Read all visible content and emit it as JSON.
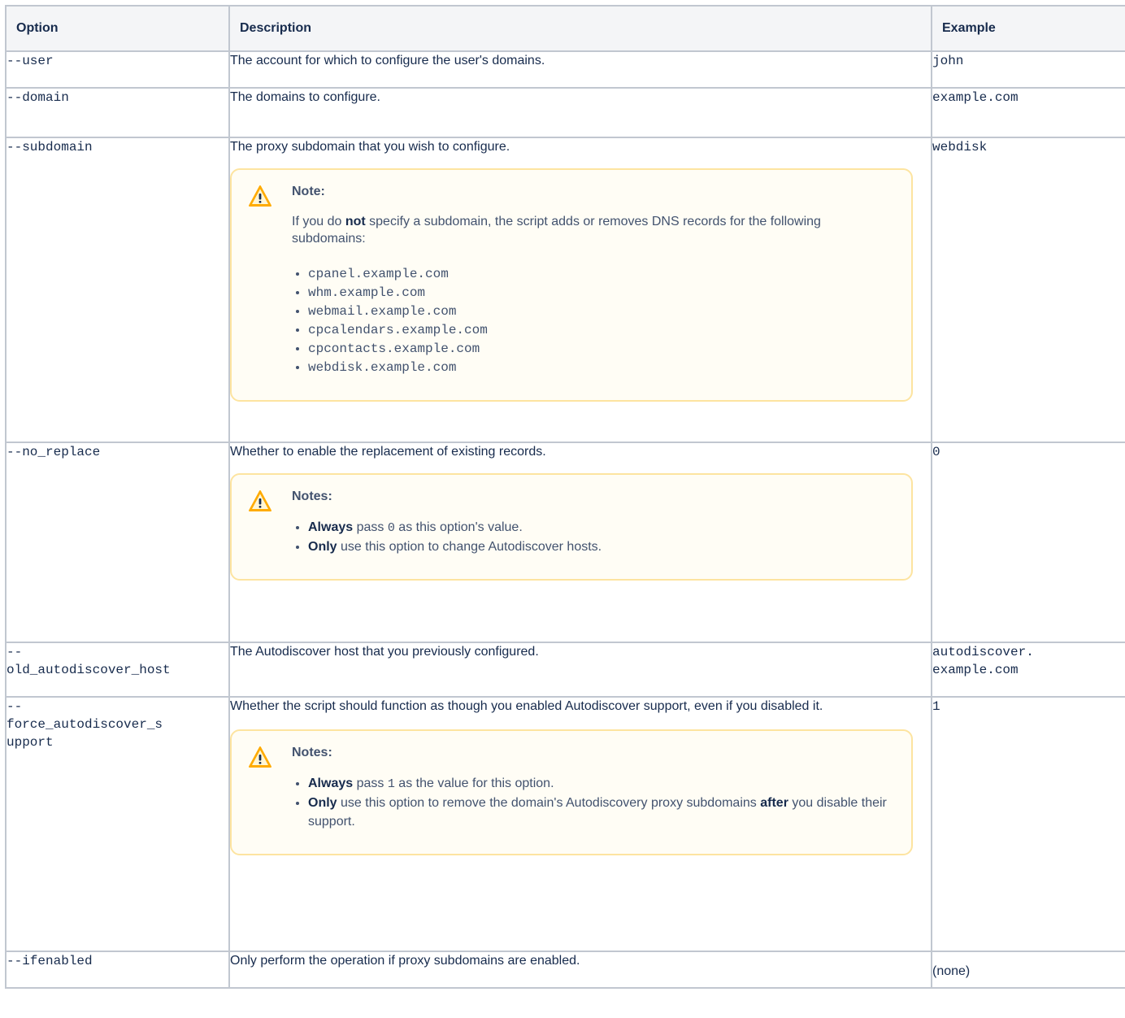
{
  "headers": {
    "option": "Option",
    "description": "Description",
    "example": "Example"
  },
  "rows": [
    {
      "option": "--user",
      "description": "The account for which to configure the user's domains.",
      "example": "john"
    },
    {
      "option": "--domain",
      "description": "The domains to configure.",
      "example": "example.com"
    },
    {
      "option": "--subdomain",
      "description": "The proxy subdomain that you wish to configure.",
      "example": "webdisk",
      "note": {
        "title": "Note:",
        "para": {
          "pre": "If you do ",
          "bold": "not",
          "post": " specify a subdomain, the script adds or removes DNS records for the following subdomains:"
        },
        "items": [
          "cpanel.example.com",
          "whm.example.com",
          "webmail.example.com",
          "cpcalendars.example.com",
          "cpcontacts.example.com",
          "webdisk.example.com"
        ]
      }
    },
    {
      "option": "--no_replace",
      "description": "Whether to enable the replacement of existing records.",
      "example": "0",
      "note": {
        "title": "Notes:",
        "items": [
          {
            "bold": "Always",
            "pre": " pass ",
            "code": "0",
            "post": " as this option's value."
          },
          {
            "bold": "Only",
            "pre": " use this option to change Autodiscover hosts."
          }
        ]
      }
    },
    {
      "option": "--old_autodiscover_host",
      "option_lines": [
        "--",
        "old_autodiscover_host"
      ],
      "description": "The Autodiscover host that you previously configured.",
      "example_lines": [
        "autodiscover.",
        "example.com"
      ]
    },
    {
      "option": "--force_autodiscover_support",
      "option_lines": [
        "--",
        "force_autodiscover_s",
        "upport"
      ],
      "description": "Whether the script should function as though you enabled Autodiscover support, even if you disabled it.",
      "example": "1",
      "note": {
        "title": "Notes:",
        "items": [
          {
            "bold": "Always",
            "pre": " pass ",
            "code": "1",
            "post": " as the value for this option."
          },
          {
            "bold": "Only",
            "pre": " use this option to remove the domain's Autodiscovery proxy subdomains ",
            "bold2": "after",
            "post": " you disable their support."
          }
        ]
      }
    },
    {
      "option": "--ifenabled",
      "description": "Only perform the operation if proxy subdomains are enabled.",
      "example": "(none)"
    }
  ],
  "icons": {
    "note_icon": "warning-triangle-icon"
  },
  "colors": {
    "warning": "#ffab00",
    "note_bg": "#fffdf5",
    "note_border": "#fde4a0",
    "header_bg": "#f4f5f7",
    "border": "#c1c7d0"
  }
}
